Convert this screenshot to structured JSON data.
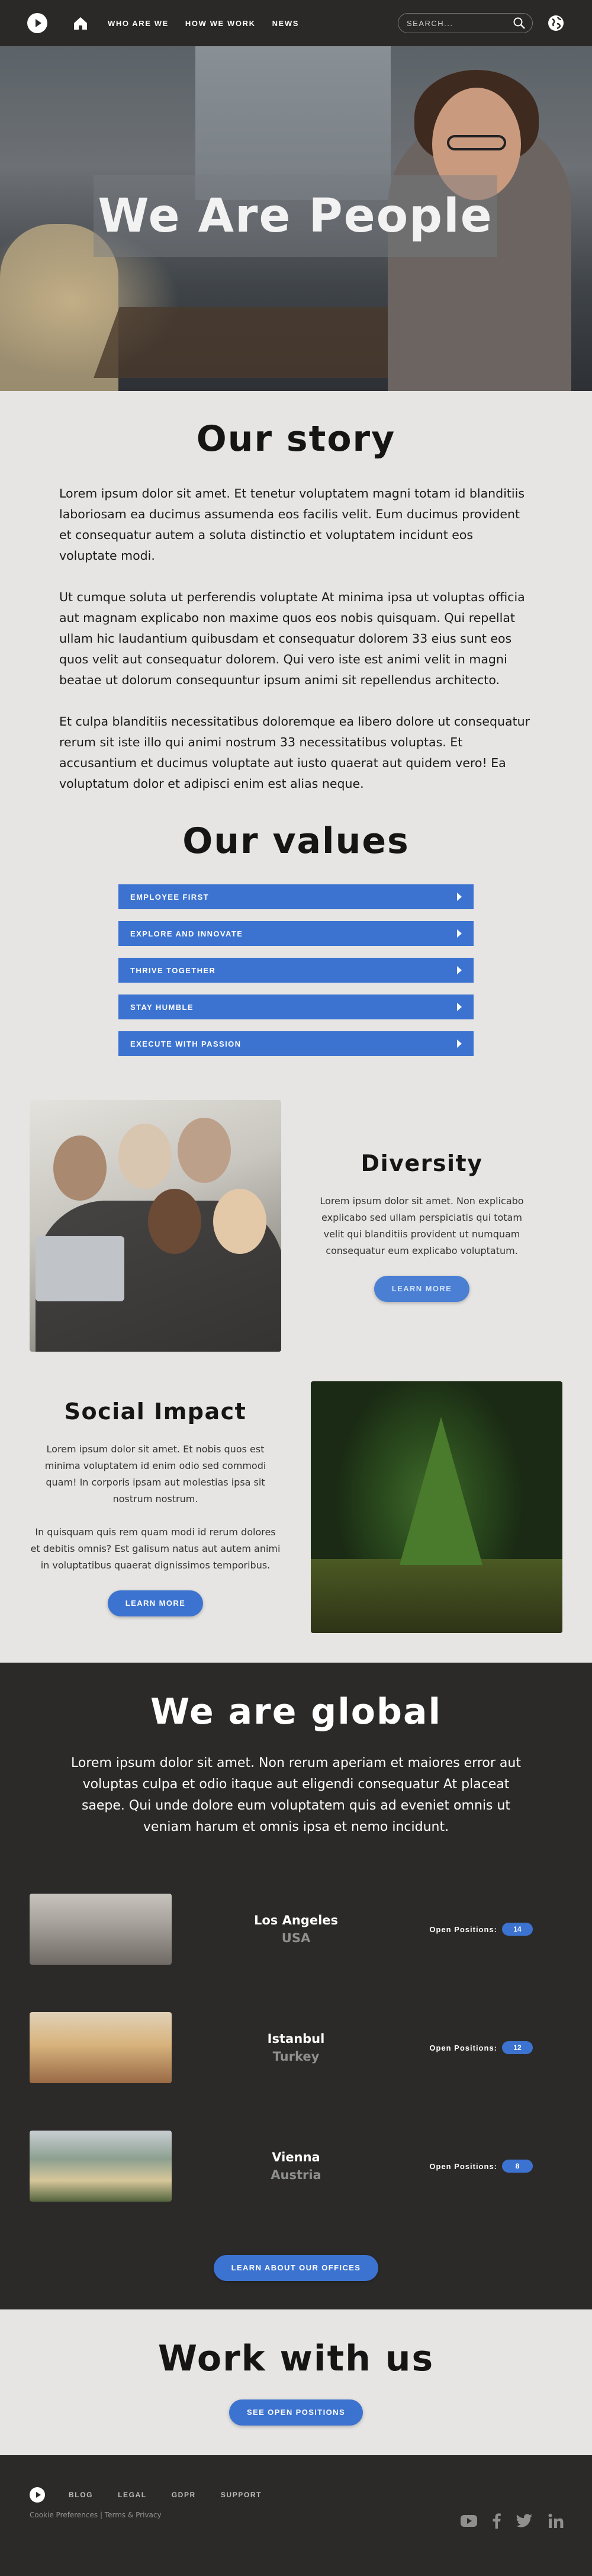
{
  "nav": {
    "links": [
      "WHO ARE WE",
      "HOW WE WORK",
      "NEWS"
    ],
    "search_placeholder": "SEARCH..."
  },
  "hero": {
    "title": "We Are People"
  },
  "story": {
    "title": "Our story",
    "paragraphs": [
      "Lorem ipsum dolor sit amet. Et tenetur voluptatem magni totam id blanditiis laboriosam ea ducimus assumenda eos facilis velit. Eum ducimus provident et consequatur autem a soluta distinctio et voluptatem incidunt eos voluptate modi.",
      "Ut cumque soluta ut perferendis voluptate At minima ipsa ut voluptas officia aut magnam explicabo non maxime quos eos nobis quisquam. Qui repellat ullam hic laudantium quibusdam et consequatur dolorem 33 eius sunt eos quos velit aut consequatur dolorem. Qui vero iste est animi velit in magni beatae ut dolorum consequuntur ipsum animi sit repellendus architecto.",
      "Et culpa blanditiis necessitatibus doloremque ea libero dolore ut consequatur rerum sit iste illo qui animi nostrum 33 necessitatibus voluptas. Et accusantium et ducimus voluptate aut iusto quaerat aut quidem vero! Ea voluptatum dolor et adipisci enim est alias neque."
    ]
  },
  "values": {
    "title": "Our values",
    "items": [
      "EMPLOYEE FIRST",
      "EXPLORE AND INNOVATE",
      "THRIVE TOGETHER",
      "STAY HUMBLE",
      "EXECUTE WITH PASSION"
    ]
  },
  "diversity": {
    "title": "Diversity",
    "body": "Lorem ipsum dolor sit amet. Non explicabo explicabo sed ullam perspiciatis qui totam velit qui blanditiis provident ut numquam consequatur eum explicabo voluptatum.",
    "button": "LEARN MORE"
  },
  "social_impact": {
    "title": "Social Impact",
    "paragraphs": [
      "Lorem ipsum dolor sit amet. Et nobis quos est minima voluptatem id enim odio sed commodi quam! In corporis ipsam aut molestias ipsa sit nostrum nostrum.",
      "In quisquam quis rem quam modi id rerum dolores et debitis omnis? Est galisum natus aut autem animi in voluptatibus quaerat dignissimos temporibus."
    ],
    "button": "LEARN MORE"
  },
  "global": {
    "title": "We are global",
    "text": "Lorem ipsum dolor sit amet. Non rerum aperiam et maiores error aut voluptas culpa et odio itaque aut eligendi consequatur At placeat saepe. Qui unde dolore eum voluptatem quis ad eveniet omnis ut veniam harum et omnis ipsa et nemo incidunt.",
    "positions_label": "Open Positions:",
    "offices": [
      {
        "city": "Los Angeles",
        "country": "USA",
        "open_positions": "14"
      },
      {
        "city": "Istanbul",
        "country": "Turkey",
        "open_positions": "12"
      },
      {
        "city": "Vienna",
        "country": "Austria",
        "open_positions": "8"
      }
    ],
    "button": "LEARN ABOUT OUR OFFICES"
  },
  "work": {
    "title": "Work with us",
    "button": "SEE OPEN POSITIONS"
  },
  "footer": {
    "links": [
      "BLOG",
      "LEGAL",
      "GDPR",
      "SUPPORT"
    ],
    "legal_cookie": "Cookie Preferences",
    "legal_sep": " | ",
    "legal_terms": "Terms & Privacy",
    "social_icons": [
      "youtube-icon",
      "facebook-icon",
      "twitter-icon",
      "linkedin-icon"
    ]
  },
  "colors": {
    "accent": "#3c73d0",
    "dark": "#2b2a29",
    "light": "#e6e5e3"
  }
}
